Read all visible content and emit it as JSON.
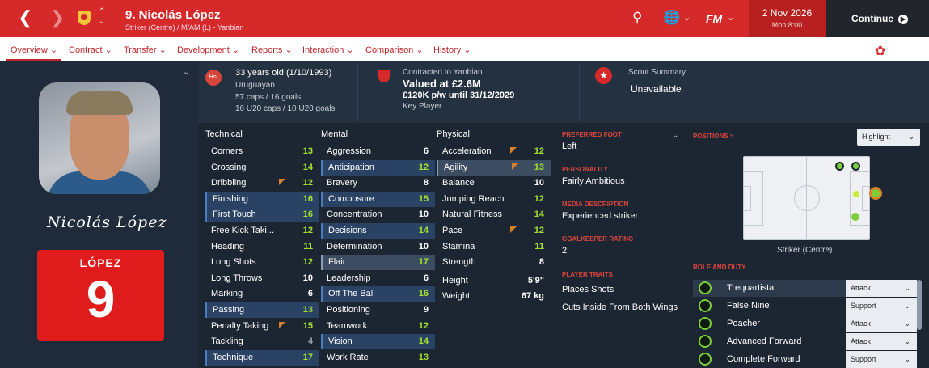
{
  "header": {
    "player_title": "9. Nicolás López",
    "player_subtitle": "Striker (Centre) / M/AM (L) - Yanbian",
    "date": "2 Nov 2026",
    "time": "Mon 8:00",
    "continue_label": "Continue",
    "fm_label": "FM"
  },
  "tabs": [
    {
      "label": "Overview"
    },
    {
      "label": "Contract"
    },
    {
      "label": "Transfer"
    },
    {
      "label": "Development"
    },
    {
      "label": "Reports"
    },
    {
      "label": "Interaction"
    },
    {
      "label": "Comparison"
    },
    {
      "label": "History"
    }
  ],
  "profile": {
    "nation_badge": "Hol",
    "signature": "Nicolás López",
    "shirt_name": "LÓPEZ",
    "shirt_number": "9"
  },
  "info": {
    "age": "33 years old (1/10/1993)",
    "nationality": "Uruguayan",
    "caps": "57 caps / 16 goals",
    "u20_caps": "16 U20 caps / 10 U20 goals",
    "contracted_to": "Contracted to Yanbian",
    "valued_at": "Valued at £2.6M",
    "wage": "£120K p/w until 31/12/2029",
    "squad_status": "Key Player",
    "scout_label": "Scout Summary",
    "scout_value": "Unavailable"
  },
  "attributes": {
    "technical_title": "Technical",
    "mental_title": "Mental",
    "physical_title": "Physical",
    "technical": [
      {
        "name": "Corners",
        "value": "13"
      },
      {
        "name": "Crossing",
        "value": "14"
      },
      {
        "name": "Dribbling",
        "value": "12"
      },
      {
        "name": "Finishing",
        "value": "16"
      },
      {
        "name": "First Touch",
        "value": "16"
      },
      {
        "name": "Free Kick Taki...",
        "value": "12"
      },
      {
        "name": "Heading",
        "value": "11"
      },
      {
        "name": "Long Shots",
        "value": "12"
      },
      {
        "name": "Long Throws",
        "value": "10"
      },
      {
        "name": "Marking",
        "value": "6"
      },
      {
        "name": "Passing",
        "value": "13"
      },
      {
        "name": "Penalty Taking",
        "value": "15"
      },
      {
        "name": "Tackling",
        "value": "4"
      },
      {
        "name": "Technique",
        "value": "17"
      }
    ],
    "mental": [
      {
        "name": "Aggression",
        "value": "6"
      },
      {
        "name": "Anticipation",
        "value": "12"
      },
      {
        "name": "Bravery",
        "value": "8"
      },
      {
        "name": "Composure",
        "value": "15"
      },
      {
        "name": "Concentration",
        "value": "10"
      },
      {
        "name": "Decisions",
        "value": "14"
      },
      {
        "name": "Determination",
        "value": "10"
      },
      {
        "name": "Flair",
        "value": "17"
      },
      {
        "name": "Leadership",
        "value": "6"
      },
      {
        "name": "Off The Ball",
        "value": "16"
      },
      {
        "name": "Positioning",
        "value": "9"
      },
      {
        "name": "Teamwork",
        "value": "12"
      },
      {
        "name": "Vision",
        "value": "14"
      },
      {
        "name": "Work Rate",
        "value": "13"
      }
    ],
    "physical": [
      {
        "name": "Acceleration",
        "value": "12"
      },
      {
        "name": "Agility",
        "value": "13"
      },
      {
        "name": "Balance",
        "value": "10"
      },
      {
        "name": "Jumping Reach",
        "value": "12"
      },
      {
        "name": "Natural Fitness",
        "value": "14"
      },
      {
        "name": "Pace",
        "value": "12"
      },
      {
        "name": "Stamina",
        "value": "11"
      },
      {
        "name": "Strength",
        "value": "8"
      }
    ],
    "height_label": "Height",
    "height": "5'9\"",
    "weight_label": "Weight",
    "weight": "67 kg"
  },
  "details": {
    "preferred_foot_label": "PREFERRED FOOT",
    "preferred_foot": "Left",
    "personality_label": "PERSONALITY",
    "personality": "Fairly Ambitious",
    "media_label": "MEDIA DESCRIPTION",
    "media": "Experienced striker",
    "gk_label": "GOALKEEPER RATING",
    "gk": "2",
    "traits_label": "PLAYER TRAITS",
    "traits": [
      "Places Shots",
      "Cuts Inside From Both Wings"
    ]
  },
  "positions": {
    "title": "POSITIONS >",
    "highlight_label": "Highlight",
    "position_caption": "Striker (Centre)",
    "role_title": "ROLE AND DUTY",
    "roles": [
      {
        "name": "Trequartista",
        "duty": "Attack"
      },
      {
        "name": "False Nine",
        "duty": "Support"
      },
      {
        "name": "Poacher",
        "duty": "Attack"
      },
      {
        "name": "Advanced Forward",
        "duty": "Attack"
      },
      {
        "name": "Complete Forward",
        "duty": "Support"
      }
    ]
  },
  "colors": {
    "brand_red": "#d62a2a",
    "value_green": "#a6e22e",
    "accent_orange": "#d5822a"
  }
}
